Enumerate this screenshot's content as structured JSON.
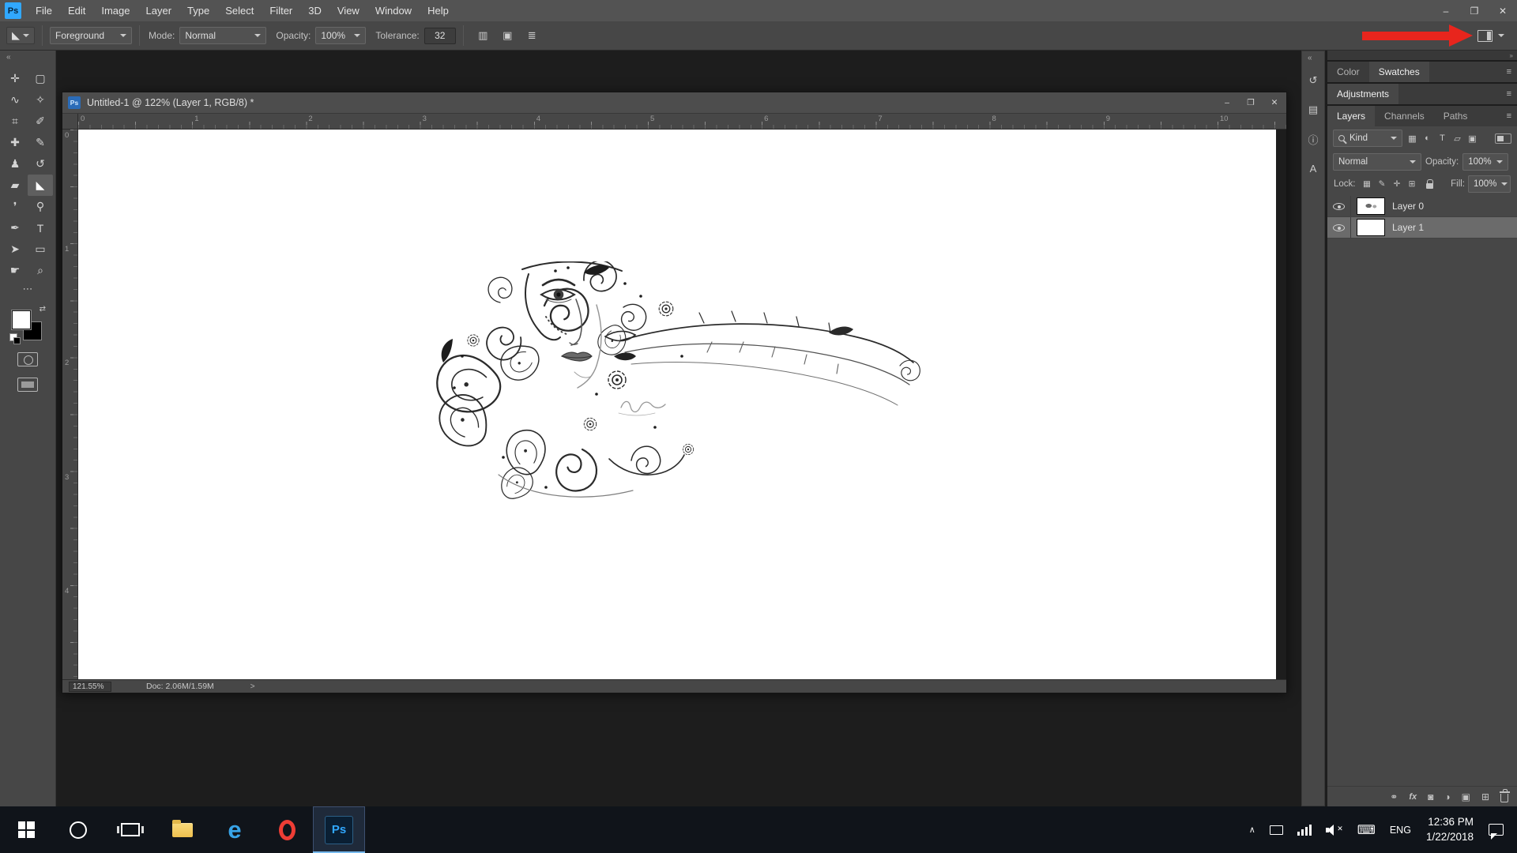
{
  "icons": {
    "minimize": "–",
    "restore": "❐",
    "close": "✕",
    "menu": "≡",
    "collapse_left": "«",
    "collapse_right": "»",
    "ellipsis": "⋯",
    "tray_caret": "∧",
    "keyboard": "⌨",
    "status_chevron": ">",
    "swap_arrows": "⇄",
    "mute_x": "✕"
  },
  "menu_bar": {
    "logo": "Ps",
    "items": [
      "File",
      "Edit",
      "Image",
      "Layer",
      "Type",
      "Select",
      "Filter",
      "3D",
      "View",
      "Window",
      "Help"
    ]
  },
  "options_bar": {
    "tool_glyph": "◣",
    "preset_value": "Foreground",
    "mode_label": "Mode:",
    "mode_value": "Normal",
    "opacity_label": "Opacity:",
    "opacity_value": "100%",
    "tolerance_label": "Tolerance:",
    "tolerance_value": "32",
    "option_icons": [
      {
        "name": "anti-alias-icon",
        "glyph": "▥"
      },
      {
        "name": "contiguous-icon",
        "glyph": "▣"
      },
      {
        "name": "all-layers-icon",
        "glyph": "≣"
      }
    ]
  },
  "toolbar": {
    "tools": [
      {
        "name": "move-tool",
        "glyph": "✛"
      },
      {
        "name": "marquee-tool",
        "glyph": "▢"
      },
      {
        "name": "lasso-tool",
        "glyph": "∿"
      },
      {
        "name": "quick-selection-tool",
        "glyph": "✧"
      },
      {
        "name": "crop-tool",
        "glyph": "⌗"
      },
      {
        "name": "eyedropper-tool",
        "glyph": "✐"
      },
      {
        "name": "healing-brush-tool",
        "glyph": "✚"
      },
      {
        "name": "brush-tool",
        "glyph": "✎"
      },
      {
        "name": "clone-stamp-tool",
        "glyph": "♟"
      },
      {
        "name": "history-brush-tool",
        "glyph": "↺"
      },
      {
        "name": "eraser-tool",
        "glyph": "▰"
      },
      {
        "name": "paint-bucket-tool",
        "glyph": "◣",
        "selected": true
      },
      {
        "name": "blur-tool",
        "glyph": "❜"
      },
      {
        "name": "dodge-tool",
        "glyph": "⚲"
      },
      {
        "name": "pen-tool",
        "glyph": "✒"
      },
      {
        "name": "type-tool",
        "glyph": "T"
      },
      {
        "name": "path-selection-tool",
        "glyph": "➤"
      },
      {
        "name": "rectangle-tool",
        "glyph": "▭"
      },
      {
        "name": "hand-tool",
        "glyph": "☛"
      },
      {
        "name": "zoom-tool",
        "glyph": "⌕"
      }
    ]
  },
  "document": {
    "title": "Untitled-1 @ 122% (Layer 1, RGB/8) *",
    "doc_icon_label": "Ps",
    "ruler_top": [
      "0",
      "1",
      "2",
      "3",
      "4",
      "5",
      "6",
      "7",
      "8",
      "9",
      "10"
    ],
    "ruler_left": [
      "0",
      "1",
      "2",
      "3",
      "4"
    ],
    "status": {
      "zoom": "121.55%",
      "doc_sizes": "Doc: 2.06M/1.59M"
    }
  },
  "panel_strip": {
    "icons": [
      {
        "name": "history-panel-icon",
        "glyph": "↺"
      },
      {
        "name": "properties-panel-icon",
        "glyph": "▤"
      },
      {
        "name": "info-panel-icon",
        "glyph": "ⓘ"
      },
      {
        "name": "character-panel-icon",
        "glyph": "A"
      }
    ]
  },
  "panels": {
    "color_tabs": [
      "Color",
      "Swatches"
    ],
    "adjustments_label": "Adjustments",
    "layers_tabs": [
      "Layers",
      "Channels",
      "Paths"
    ],
    "layers": {
      "kind_value": "Kind",
      "filter_icons": [
        {
          "name": "filter-pixel-icon",
          "glyph": "▦"
        },
        {
          "name": "filter-adjustment-icon",
          "glyph": "◐"
        },
        {
          "name": "filter-type-icon",
          "glyph": "T"
        },
        {
          "name": "filter-shape-icon",
          "glyph": "▱"
        },
        {
          "name": "filter-smart-object-icon",
          "glyph": "▣"
        }
      ],
      "blend_value": "Normal",
      "opacity_label": "Opacity:",
      "opacity_value": "100%",
      "lock_label": "Lock:",
      "lock_icons": [
        {
          "name": "lock-transparency-icon",
          "glyph": "▦"
        },
        {
          "name": "lock-pixels-icon",
          "glyph": "✎"
        },
        {
          "name": "lock-position-icon",
          "glyph": "✛"
        },
        {
          "name": "lock-artboard-icon",
          "glyph": "⊞"
        }
      ],
      "fill_label": "Fill:",
      "fill_value": "100%",
      "items": [
        {
          "name": "Layer 0"
        },
        {
          "name": "Layer 1",
          "selected": true
        }
      ],
      "footer": {
        "link": "⚭",
        "fx": "fx",
        "mask": "◙",
        "adjust": "◑",
        "group": "▣",
        "new_layer": "⊞"
      }
    }
  },
  "taskbar": {
    "ps_label": "Ps",
    "tray": {
      "lang": "ENG",
      "time": "12:36 PM",
      "date": "1/22/2018"
    }
  }
}
